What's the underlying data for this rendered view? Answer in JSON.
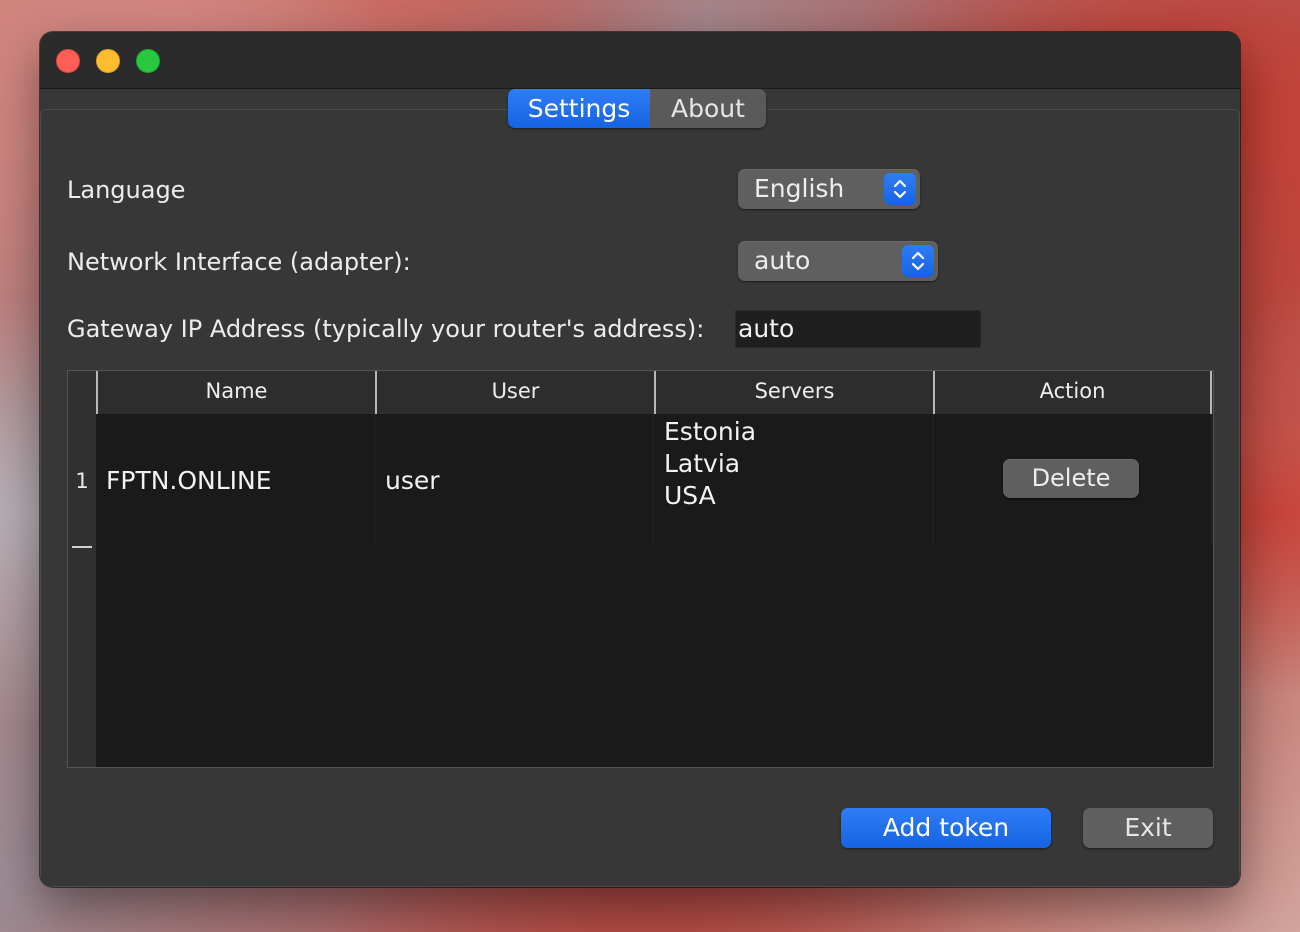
{
  "tabs": [
    {
      "label": "Settings",
      "active": true
    },
    {
      "label": "About",
      "active": false
    }
  ],
  "settings": {
    "language_label": "Language",
    "language_value": "English",
    "interface_label": "Network Interface (adapter):",
    "interface_value": "auto",
    "gateway_label": "Gateway IP Address (typically your router's address):",
    "gateway_value": "auto"
  },
  "table": {
    "columns": [
      "Name",
      "User",
      "Servers",
      "Action"
    ],
    "rows": [
      {
        "index": "1",
        "name": "FPTN.ONLINE",
        "user": "user",
        "servers": [
          "Estonia",
          "Latvia",
          "USA"
        ],
        "action": "Delete"
      }
    ]
  },
  "buttons": {
    "add_token": "Add token",
    "exit": "Exit"
  },
  "colors": {
    "accent": "#1a6ae8",
    "window_bg": "#373737",
    "table_bg": "#1b1b1b"
  },
  "icons": {
    "select_stepper": "up-down-chevron-icon"
  }
}
